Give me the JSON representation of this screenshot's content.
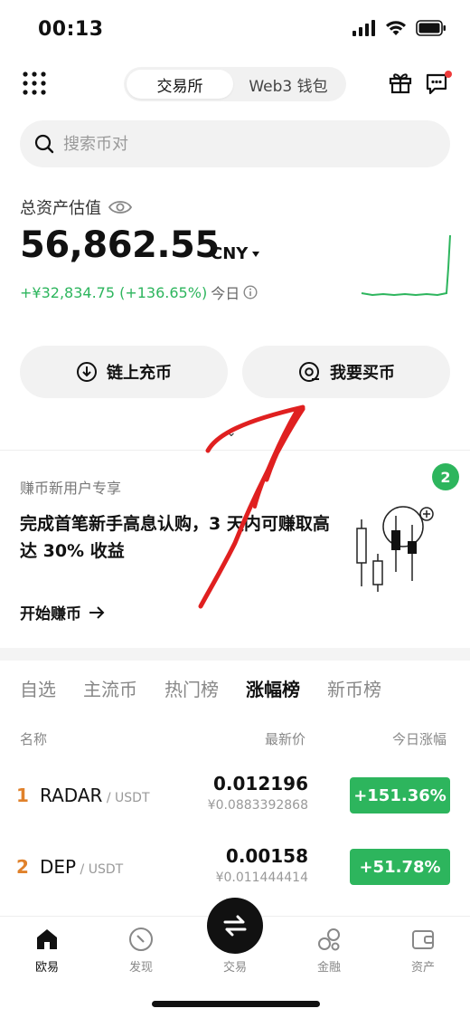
{
  "status": {
    "time": "00:13"
  },
  "header": {
    "segments": [
      "交易所",
      "Web3 钱包"
    ],
    "active_segment": "交易所"
  },
  "search": {
    "placeholder": "搜索币对"
  },
  "assets": {
    "label": "总资产估值",
    "value": "56,862.55",
    "currency": "CNY",
    "change_amount": "+¥32,834.75 (+136.65%)",
    "change_period": "今日"
  },
  "actions": {
    "deposit": "链上充币",
    "buy": "我要买币"
  },
  "promo": {
    "subtitle": "赚币新用户专享",
    "title": "完成首笔新手高息认购，3 天内可赚取高达 30% 收益",
    "link": "开始赚币",
    "badge": "2"
  },
  "market": {
    "tabs": [
      "自选",
      "主流币",
      "热门榜",
      "涨幅榜",
      "新币榜"
    ],
    "active_tab": "涨幅榜",
    "columns": {
      "name": "名称",
      "price": "最新价",
      "change": "今日涨幅"
    },
    "rows": [
      {
        "rank": "1",
        "symbol": "RADAR",
        "quote": " / USDT",
        "price": "0.012196",
        "fiat": "¥0.0883392868",
        "change": "+151.36%"
      },
      {
        "rank": "2",
        "symbol": "DEP",
        "quote": " / USDT",
        "price": "0.00158",
        "fiat": "¥0.011444414",
        "change": "+51.78%"
      }
    ]
  },
  "nav": {
    "items": [
      {
        "label": "欧易",
        "icon": "home-icon"
      },
      {
        "label": "发现",
        "icon": "discover-icon"
      },
      {
        "label": "交易",
        "icon": "trade-icon"
      },
      {
        "label": "金融",
        "icon": "finance-icon"
      },
      {
        "label": "资产",
        "icon": "wallet-icon"
      }
    ],
    "active": "欧易"
  },
  "colors": {
    "green": "#2db55d",
    "rank": "#e0812b",
    "annotation": "#e02020"
  }
}
